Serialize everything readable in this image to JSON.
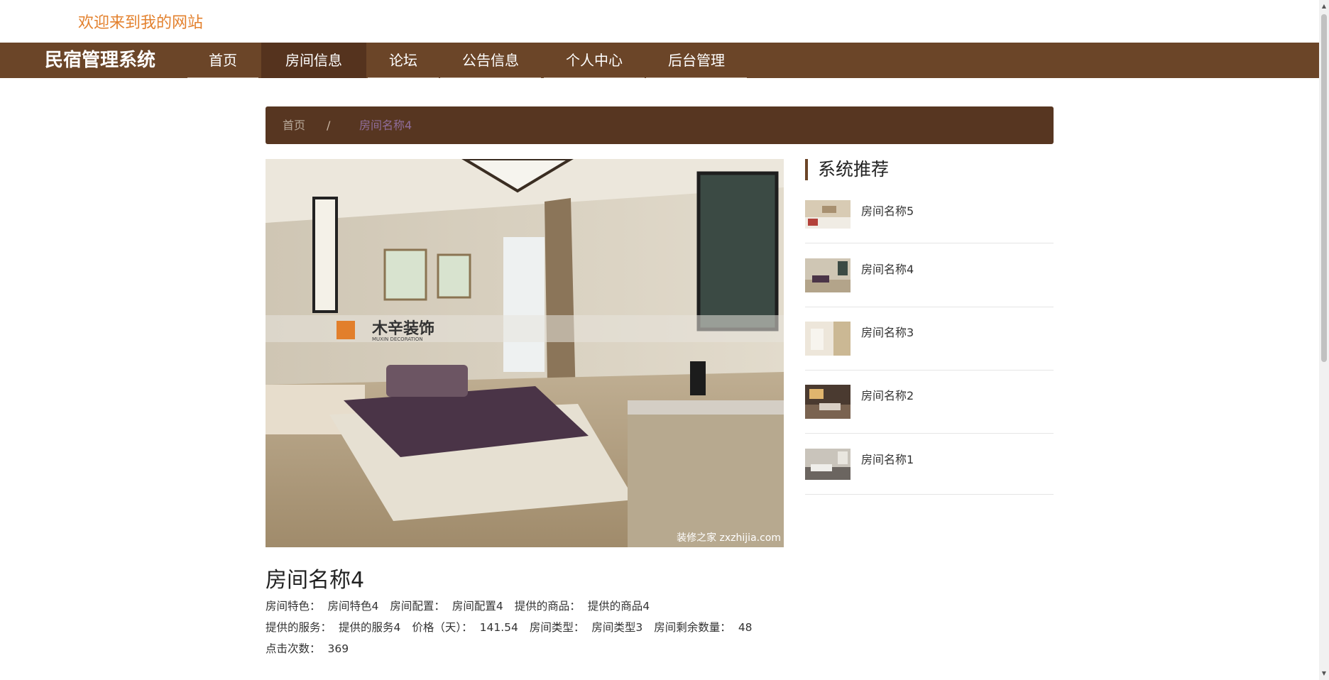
{
  "header": {
    "welcome": "欢迎来到我的网站"
  },
  "navbar": {
    "brand": "民宿管理系统",
    "items": [
      {
        "label": "首页"
      },
      {
        "label": "房间信息",
        "active": true
      },
      {
        "label": "论坛"
      },
      {
        "label": "公告信息"
      },
      {
        "label": "个人中心"
      },
      {
        "label": "后台管理"
      }
    ]
  },
  "breadcrumb": {
    "home": "首页",
    "separator": "/",
    "current": "房间名称4"
  },
  "detail": {
    "image_watermark": "装修之家 zxzhijia.com",
    "image_logo_text": "木辛装饰",
    "image_logo_subtext": "MUXIN DECORATION",
    "title": "房间名称4",
    "fields": {
      "feature_label": "房间特色：",
      "feature_value": "房间特色4",
      "config_label": "房间配置：",
      "config_value": "房间配置4",
      "goods_label": "提供的商品：",
      "goods_value": "提供的商品4",
      "service_label": "提供的服务：",
      "service_value": "提供的服务4",
      "price_label": "价格（天）：",
      "price_value": "141.54",
      "type_label": "房间类型：",
      "type_value": "房间类型3",
      "remaining_label": "房间剩余数量：",
      "remaining_value": "48",
      "clicks_label": "点击次数：",
      "clicks_value": "369"
    }
  },
  "recommend": {
    "heading": "系统推荐",
    "items": [
      {
        "name": "房间名称5"
      },
      {
        "name": "房间名称4"
      },
      {
        "name": "房间名称3"
      },
      {
        "name": "房间名称2"
      },
      {
        "name": "房间名称1"
      }
    ]
  },
  "colors": {
    "navbar": "#6b4528",
    "nav_active": "#55331e",
    "breadcrumb": "#573621",
    "welcome": "#e3812e",
    "crumb_current": "#8f6d9b"
  }
}
